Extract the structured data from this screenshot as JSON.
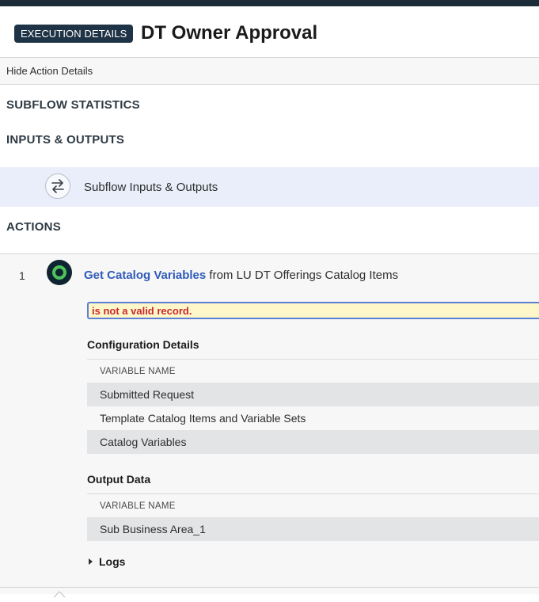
{
  "header": {
    "badge": "EXECUTION DETAILS",
    "title": "DT Owner Approval"
  },
  "hide_link": "Hide Action Details",
  "sections": {
    "subflow_statistics": "SUBFLOW STATISTICS",
    "inputs_outputs": "INPUTS & OUTPUTS",
    "actions": "ACTIONS"
  },
  "io_row": {
    "label": "Subflow Inputs & Outputs",
    "icon": "swap-arrows-icon"
  },
  "action": {
    "index": "1",
    "name": "Get Catalog Variables",
    "rest": " from LU DT Offerings Catalog Items",
    "icon": "action-status-icon",
    "error": "is not a valid record.",
    "config": {
      "heading": "Configuration Details",
      "column": "VARIABLE NAME",
      "rows": [
        "Submitted Request",
        "Template Catalog Items and Variable Sets",
        "Catalog Variables"
      ]
    },
    "output": {
      "heading": "Output Data",
      "column": "VARIABLE NAME",
      "rows": [
        "Sub Business Area_1"
      ]
    },
    "logs": "Logs"
  },
  "colors": {
    "topbar": "#1b2b38",
    "badge": "#1f3346",
    "io_row_bg": "#e9eefa",
    "link": "#2f5bb8",
    "error_text": "#c8282e",
    "error_bg": "#fff7c9",
    "status_green": "#4ec35a"
  }
}
